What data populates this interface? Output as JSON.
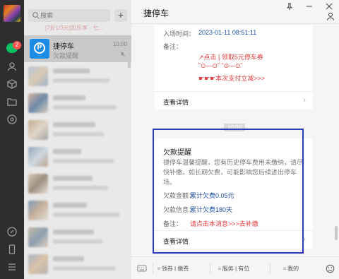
{
  "sidebar": {
    "unread_count": "2"
  },
  "session_list": {
    "search_placeholder": "搜索",
    "add_label": "+",
    "top_snippet": "[7折1/3元]凯乐享 · 七...",
    "active": {
      "name": "捷停车",
      "time": "10:00",
      "preview": "欠款提醒"
    },
    "blurred_rows": 8
  },
  "chat": {
    "title": "捷停车",
    "window_controls": [
      "pin-icon",
      "minimize-icon",
      "close-icon"
    ],
    "card1": {
      "entry_time_label": "入场时间：",
      "entry_time_value": "2023-01-11 08:51:11",
      "note_label": "备注：",
      "coupon_line1": "↗点击 | 领取5元停车券",
      "coupon_line2": "˘⊙—⊙˘  ˘⊙—⊙˘",
      "coupon_line3": "☛☛☛本次支付立减>>>",
      "footer_label": "查看详情"
    },
    "time_pill": "10:00",
    "card2": {
      "title": "欠款提醒",
      "desc": "捷停车温馨提醒，您有历史停车费用未缴纳，请尽快补缴。如长期欠费，可能影响您后续进出停车场。",
      "amount_label": "欠款金额：",
      "amount_value": "累计欠费0.05元",
      "info_label": "欠款信息：",
      "info_value": "累计欠费180天",
      "note_label": "备注：",
      "note_value": "请点击本消息>>>去补缴",
      "footer_label": "查看详情"
    },
    "menu": {
      "items": [
        "领券 | 缴费",
        "服务 | 有位",
        "我的"
      ]
    }
  },
  "colors": {
    "accent_green": "#07c160",
    "link_blue": "#1f4fa3",
    "alert_red": "#e23b3b",
    "highlight_border": "#2b3ab7"
  }
}
